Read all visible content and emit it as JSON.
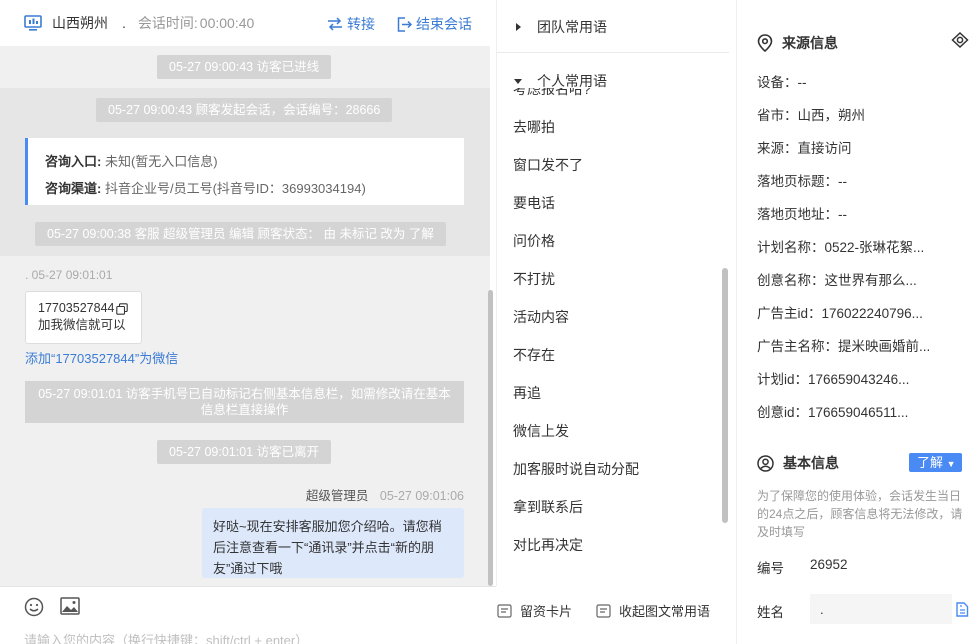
{
  "header": {
    "region": "山西朔州",
    "dot": ".",
    "time_label": "会话时间:",
    "time_value": "00:00:40",
    "transfer_label": "转接",
    "end_label": "结束会话"
  },
  "chat": {
    "visitor_entered": "05-27 09:00:43 访客已进线",
    "session_started": "05-27 09:00:43 顾客发起会话，会话编号：28666",
    "consult_card": {
      "entry_label": "咨询入口:",
      "entry_value": "未知(暂无入口信息)",
      "channel_label": "咨询渠道:",
      "channel_value": "抖音企业号/员工号(抖音号ID：36993034194)"
    },
    "status_change": "05-27 09:00:38 客服 超级管理员 编辑 顾客状态： 由 未标记 改为 了解",
    "visitor_meta": ". 05-27 09:01:01",
    "phone_bubble": {
      "phone": "17703527844",
      "text": "加我微信就可以"
    },
    "add_wechat_link": "添加“17703527844”为微信",
    "auto_tag_notice": "05-27 09:01:01 访客手机号已自动标记右侧基本信息栏，如需修改请在基本信息栏直接操作",
    "visitor_left": "05-27 09:01:01 访客已离开",
    "agent_name": "超级管理员",
    "agent_time": "05-27 09:01:06",
    "agent_message": "好哒~现在安排客服加您介绍哈。请您稍后注意查看一下“通讯录”并点击“新的朋友”通过下哦"
  },
  "input_area": {
    "card_label": "留资卡片",
    "collect_label": "收起图文常用语",
    "placeholder": "请输入您的内容（换行快捷键：shift/ctrl + enter）"
  },
  "phrases": {
    "team_group": "团队常用语",
    "personal_group": "个人常用语",
    "clipped_item": "考虑报名哈?",
    "items": [
      "去哪拍",
      "窗口发不了",
      "要电话",
      "问价格",
      "不打扰",
      "活动内容",
      "不存在",
      "再追",
      "微信上发",
      "加客服时说自动分配",
      "拿到联系后",
      "对比再决定"
    ]
  },
  "source_info": {
    "title": "来源信息",
    "rows": [
      "设备：--",
      "省市：山西，朔州",
      "来源：直接访问",
      "落地页标题：--",
      "落地页地址：--",
      "计划名称：0522-张琳花絮...",
      "创意名称：这世界有那么...",
      "广告主id：176022240796...",
      "广告主名称：提米映画婚前...",
      "计划id：176659043246...",
      "创意id：176659046511..."
    ]
  },
  "basic_info": {
    "title": "基本信息",
    "status": "了解",
    "notice": "为了保障您的使用体验，会话发生当日的24点之后，顾客信息将无法修改，请及时填写",
    "id_label": "编号",
    "id_value": "26952",
    "name_label": "姓名",
    "name_value": "."
  },
  "colors": {
    "accent": "#3a7bd5",
    "status_blue": "#4a8af4",
    "agent_bubble": "#dde8fb",
    "system_pill": "#d4d4d4",
    "chat_bg": "#f0f0f0"
  },
  "icons": [
    "monitor-icon",
    "transfer-icon",
    "logout-icon",
    "copy-icon",
    "emoji-icon",
    "image-icon",
    "card-icon",
    "collapse-icon",
    "caret-right-icon",
    "caret-down-icon",
    "location-pin-icon",
    "eye-icon",
    "user-circle-icon",
    "document-icon"
  ]
}
